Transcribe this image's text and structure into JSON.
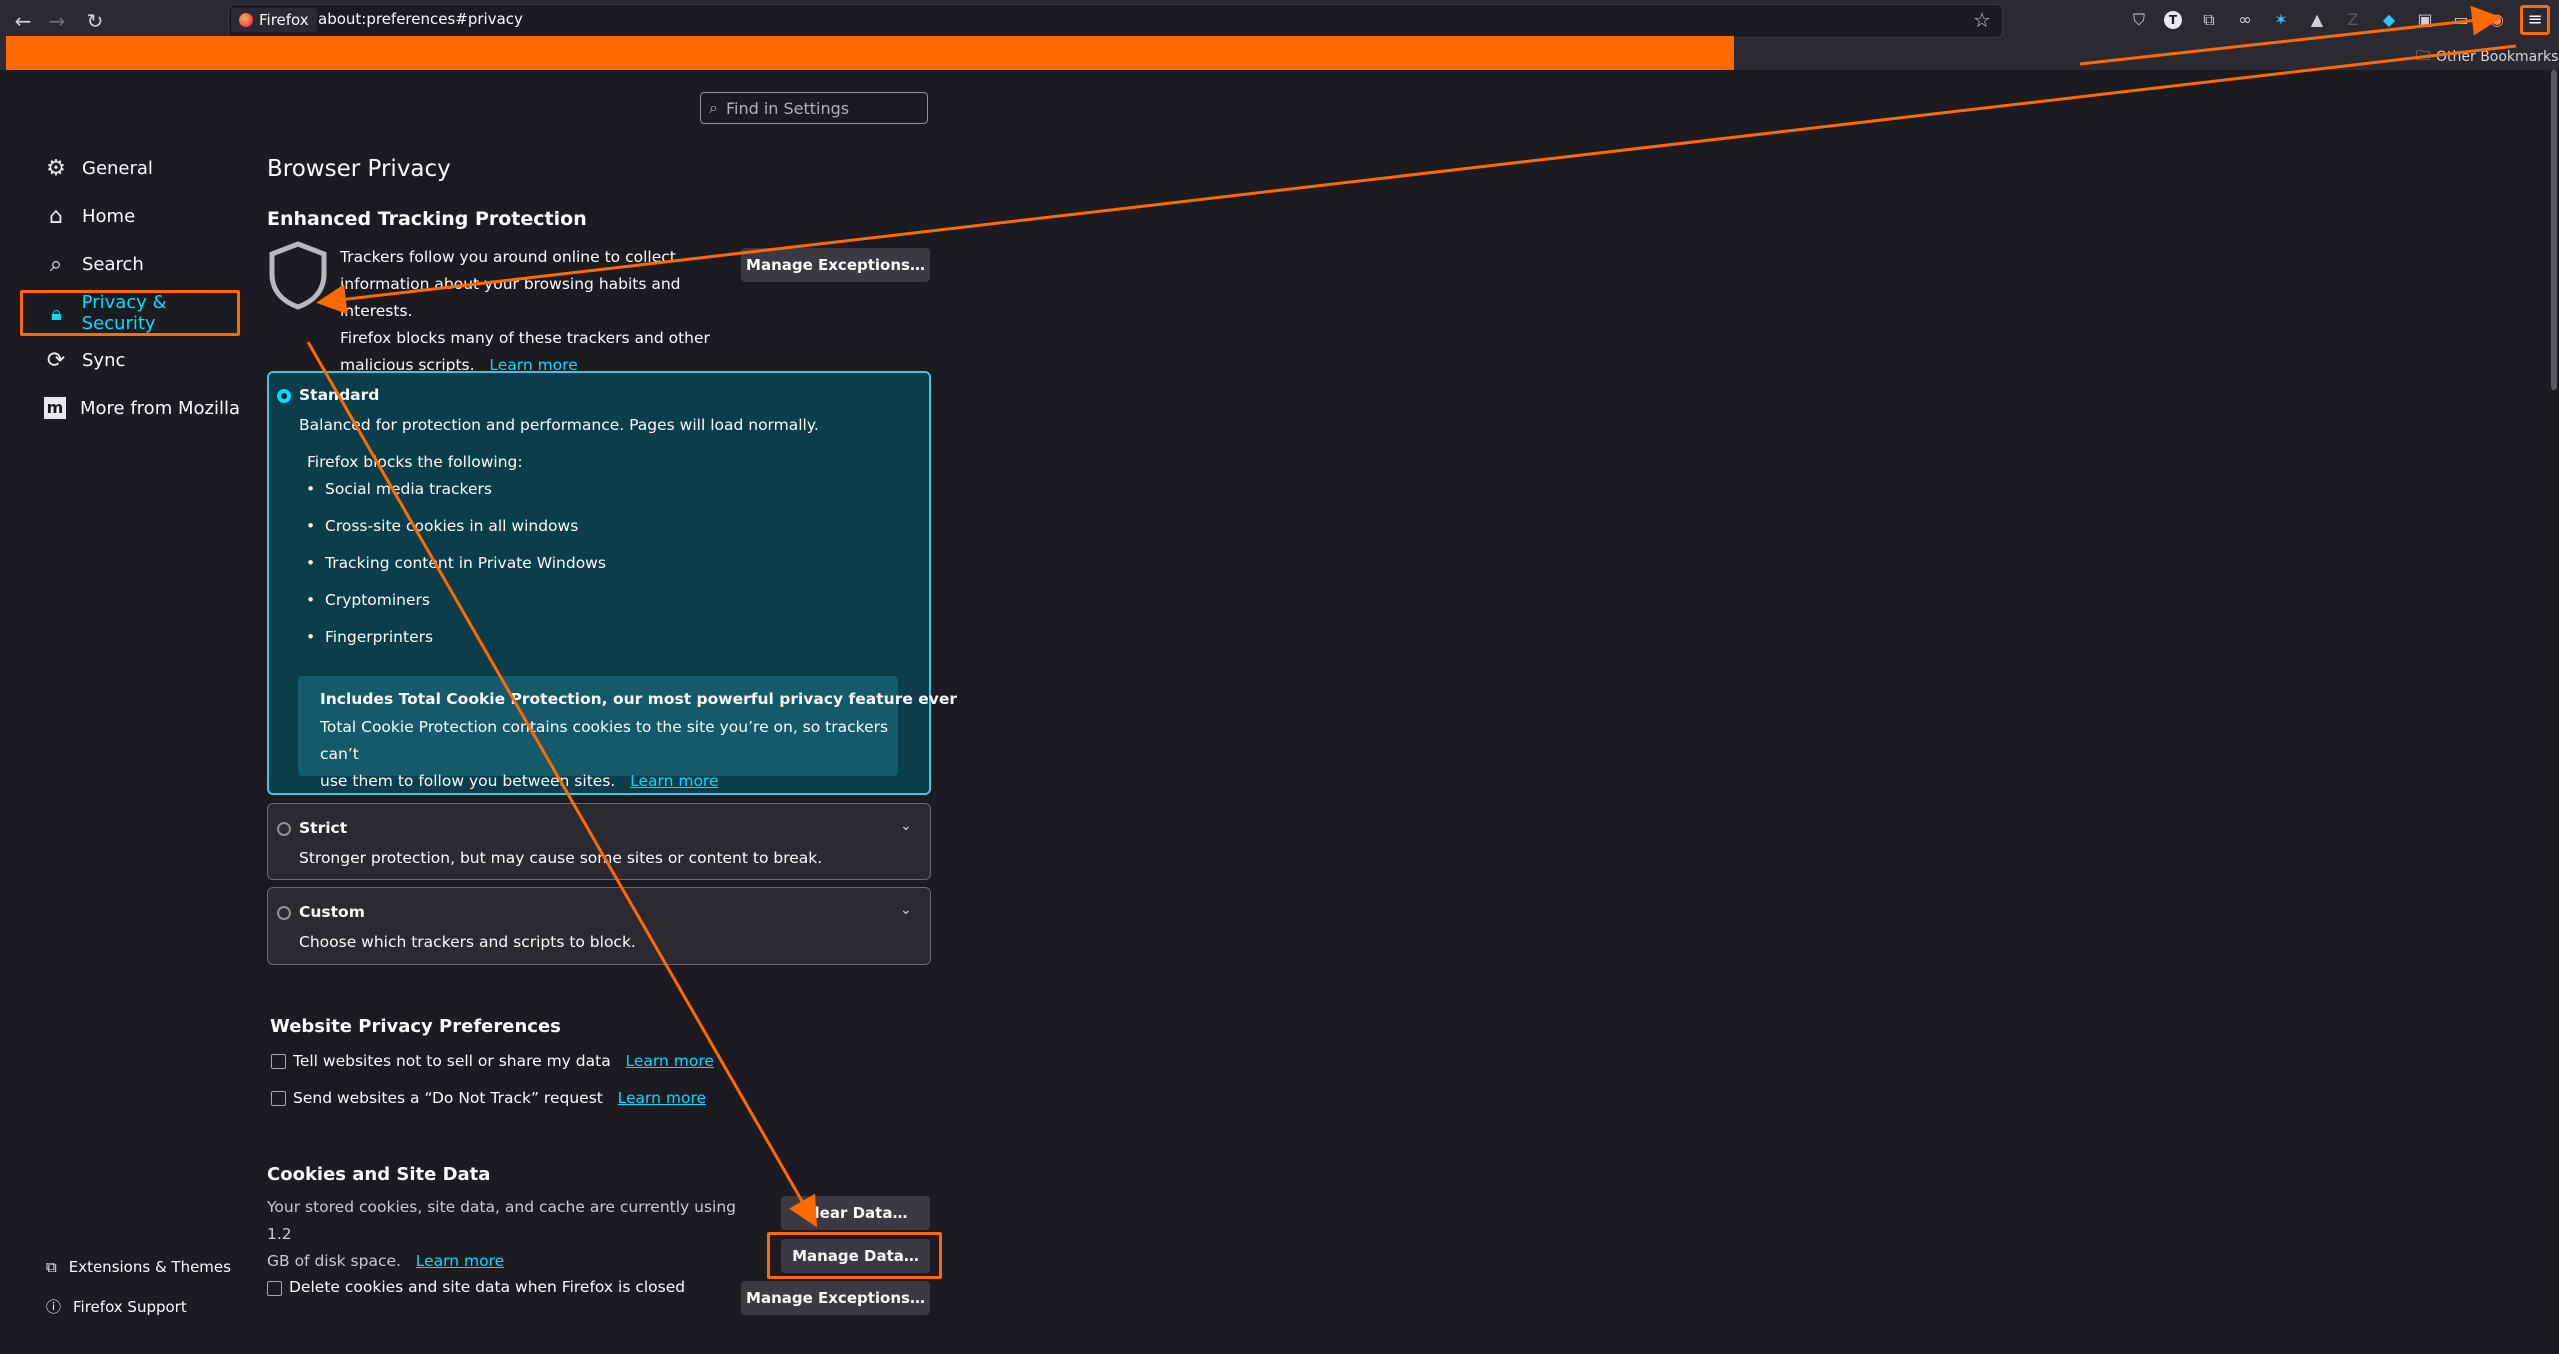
{
  "browser": {
    "back_icon": "back-arrow-icon",
    "forward_icon": "forward-arrow-icon",
    "reload_icon": "reload-icon",
    "url_badge": "Firefox",
    "url": "about:preferences#privacy",
    "other_bookmarks": "Other Bookmarks"
  },
  "search": {
    "placeholder": "Find in Settings"
  },
  "sidebar": {
    "items": [
      {
        "label": "General"
      },
      {
        "label": "Home"
      },
      {
        "label": "Search"
      },
      {
        "label": "Privacy & Security"
      },
      {
        "label": "Sync"
      },
      {
        "label": "More from Mozilla"
      }
    ],
    "footer": [
      {
        "label": "Extensions & Themes"
      },
      {
        "label": "Firefox Support"
      }
    ]
  },
  "main": {
    "title": "Browser Privacy",
    "etp": {
      "heading": "Enhanced Tracking Protection",
      "desc_line1": "Trackers follow you around online to collect",
      "desc_line2": "information about your browsing habits and interests.",
      "desc_line3": "Firefox blocks many of these trackers and other",
      "desc_line4": "malicious scripts.",
      "learn_more": "Learn more",
      "manage_exceptions": "Manage Exceptions…"
    },
    "standard": {
      "label": "Standard",
      "desc": "Balanced for protection and performance. Pages will load normally.",
      "blocks_heading": "Firefox blocks the following:",
      "bullets": [
        "Social media trackers",
        "Cross-site cookies in all windows",
        "Tracking content in Private Windows",
        "Cryptominers",
        "Fingerprinters"
      ],
      "tcp_title": "Includes Total Cookie Protection, our most powerful privacy feature ever",
      "tcp_line1": "Total Cookie Protection contains cookies to the site you’re on, so trackers can’t",
      "tcp_line2": "use them to follow you between sites.",
      "tcp_learn_more": "Learn more"
    },
    "strict": {
      "label": "Strict",
      "desc": "Stronger protection, but may cause some sites or content to break."
    },
    "custom": {
      "label": "Custom",
      "desc": "Choose which trackers and scripts to block."
    },
    "website_privacy": {
      "heading": "Website Privacy Preferences",
      "opt1": "Tell websites not to sell or share my data",
      "opt2": "Send websites a “Do Not Track” request",
      "learn_more": "Learn more"
    },
    "cookies": {
      "heading": "Cookies and Site Data",
      "desc_line1": "Your stored cookies, site data, and cache are currently using 1.2",
      "desc_line2": "GB of disk space.",
      "learn_more": "Learn more",
      "clear_data": "Clear Data…",
      "manage_data": "Manage Data…",
      "delete_on_close": "Delete cookies and site data when Firefox is closed",
      "manage_exceptions": "Manage Exceptions…"
    }
  },
  "colors": {
    "annotation": "#ff6a00",
    "link": "#00ddff",
    "background": "#1c1b22"
  }
}
